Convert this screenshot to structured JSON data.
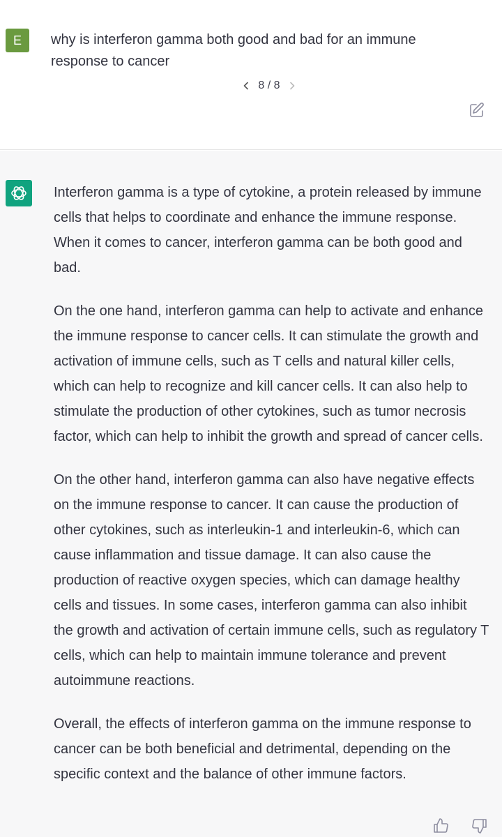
{
  "user_message": {
    "avatar_initial": "E",
    "text": "why is interferon gamma both good and bad for an immune response to cancer",
    "pager": {
      "current": 8,
      "total": 8,
      "label": "8 / 8"
    },
    "edit_icon": "edit-icon"
  },
  "assistant_message": {
    "avatar_icon": "openai-logo-icon",
    "paragraphs": [
      "Interferon gamma is a type of cytokine, a protein released by immune cells that helps to coordinate and enhance the immune response. When it comes to cancer, interferon gamma can be both good and bad.",
      "On the one hand, interferon gamma can help to activate and enhance the immune response to cancer cells. It can stimulate the growth and activation of immune cells, such as T cells and natural killer cells, which can help to recognize and kill cancer cells. It can also help to stimulate the production of other cytokines, such as tumor necrosis factor, which can help to inhibit the growth and spread of cancer cells.",
      "On the other hand, interferon gamma can also have negative effects on the immune response to cancer. It can cause the production of other cytokines, such as interleukin-1 and interleukin-6, which can cause inflammation and tissue damage. It can also cause the production of reactive oxygen species, which can damage healthy cells and tissues. In some cases, interferon gamma can also inhibit the growth and activation of certain immune cells, such as regulatory T cells, which can help to maintain immune tolerance and prevent autoimmune reactions.",
      "Overall, the effects of interferon gamma on the immune response to cancer can be both beneficial and detrimental, depending on the specific context and the balance of other immune factors."
    ],
    "feedback_icons": [
      "thumbs-up-icon",
      "thumbs-down-icon"
    ]
  },
  "colors": {
    "user_avatar": "#6a9a3f",
    "assistant_avatar": "#10a37f",
    "assistant_background": "#f7f7f8",
    "text": "#343541"
  }
}
